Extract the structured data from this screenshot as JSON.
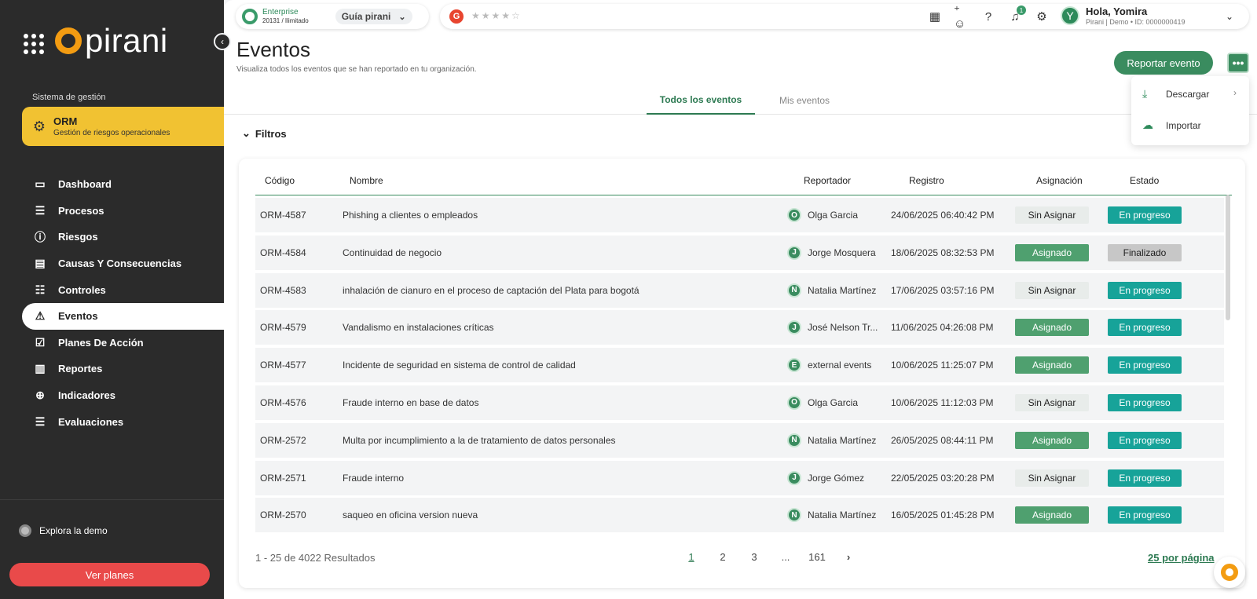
{
  "brand": {
    "name": "pirani",
    "accent": "#f39c12",
    "green": "#3a8c5f"
  },
  "sidebar": {
    "section_label": "Sistema de gestión",
    "module": {
      "title": "ORM",
      "subtitle": "Gestión de riesgos operacionales"
    },
    "items": [
      {
        "label": "Dashboard",
        "icon": "monitor-icon",
        "glyph": "▭"
      },
      {
        "label": "Procesos",
        "icon": "list-icon",
        "glyph": "☰"
      },
      {
        "label": "Riesgos",
        "icon": "alert-circle-icon",
        "glyph": "ⓘ"
      },
      {
        "label": "Causas Y Consecuencias",
        "icon": "layout-icon",
        "glyph": "▤"
      },
      {
        "label": "Controles",
        "icon": "sliders-icon",
        "glyph": "☷"
      },
      {
        "label": "Eventos",
        "icon": "warning-triangle-icon",
        "glyph": "⚠"
      },
      {
        "label": "Planes De Acción",
        "icon": "checkbox-icon",
        "glyph": "☑"
      },
      {
        "label": "Reportes",
        "icon": "bar-chart-icon",
        "glyph": "▥"
      },
      {
        "label": "Indicadores",
        "icon": "target-icon",
        "glyph": "⊕"
      },
      {
        "label": "Evaluaciones",
        "icon": "checklist-icon",
        "glyph": "☰"
      }
    ],
    "active_index": 5,
    "demo_label": "Explora la demo",
    "plans_button": "Ver planes"
  },
  "topbar": {
    "plan_title": "Enterprise",
    "plan_sub": "20131 / Ilimitado",
    "guide_label": "Guía pirani",
    "g2_label": "G",
    "stars": "★★★★☆",
    "notifications_count": "1",
    "avatar_initial": "Y",
    "user_name": "Hola, Yomira",
    "user_sub": "Pirani | Demo • ID: 0000000419"
  },
  "header": {
    "title": "Eventos",
    "subtitle": "Visualiza todos los eventos que se han reportado en tu organización.",
    "report_button": "Reportar evento",
    "more_label": "•••"
  },
  "tabs": [
    {
      "label": "Todos los eventos"
    },
    {
      "label": "Mis eventos"
    }
  ],
  "filters_label": "Filtros",
  "dropdown": {
    "items": [
      {
        "label": "Descargar"
      },
      {
        "label": "Importar"
      }
    ]
  },
  "table": {
    "columns": [
      "Código",
      "Nombre",
      "Reportador",
      "Registro",
      "Asignación",
      "Estado"
    ],
    "rows": [
      {
        "code": "ORM-4587",
        "name": "Phishing a clientes o empleados",
        "initial": "O",
        "reporter": "Olga Garcia",
        "date": "24/06/2025 06:40:42 PM",
        "assignment": "Sin Asignar",
        "assignment_kind": "unassigned",
        "status": "En progreso",
        "status_kind": "progress"
      },
      {
        "code": "ORM-4584",
        "name": "Continuidad de negocio",
        "initial": "J",
        "reporter": "Jorge Mosquera",
        "date": "18/06/2025 08:32:53 PM",
        "assignment": "Asignado",
        "assignment_kind": "assigned",
        "status": "Finalizado",
        "status_kind": "done"
      },
      {
        "code": "ORM-4583",
        "name": "inhalación de cianuro en el proceso de captación del Plata para bogotá",
        "initial": "N",
        "reporter": "Natalia Martínez",
        "date": "17/06/2025 03:57:16 PM",
        "assignment": "Sin Asignar",
        "assignment_kind": "unassigned",
        "status": "En progreso",
        "status_kind": "progress"
      },
      {
        "code": "ORM-4579",
        "name": "Vandalismo en instalaciones críticas",
        "initial": "J",
        "reporter": "José Nelson Tr...",
        "date": "11/06/2025 04:26:08 PM",
        "assignment": "Asignado",
        "assignment_kind": "assigned",
        "status": "En progreso",
        "status_kind": "progress"
      },
      {
        "code": "ORM-4577",
        "name": "Incidente de seguridad en sistema de control de calidad",
        "initial": "E",
        "reporter": "external events",
        "date": "10/06/2025 11:25:07 PM",
        "assignment": "Asignado",
        "assignment_kind": "assigned",
        "status": "En progreso",
        "status_kind": "progress"
      },
      {
        "code": "ORM-4576",
        "name": "Fraude interno en base de datos",
        "initial": "O",
        "reporter": "Olga Garcia",
        "date": "10/06/2025 11:12:03 PM",
        "assignment": "Sin Asignar",
        "assignment_kind": "unassigned",
        "status": "En progreso",
        "status_kind": "progress"
      },
      {
        "code": "ORM-2572",
        "name": "Multa por incumplimiento a la de tratamiento de datos personales",
        "initial": "N",
        "reporter": "Natalia Martínez",
        "date": "26/05/2025 08:44:11 PM",
        "assignment": "Asignado",
        "assignment_kind": "assigned",
        "status": "En progreso",
        "status_kind": "progress"
      },
      {
        "code": "ORM-2571",
        "name": "Fraude interno",
        "initial": "J",
        "reporter": "Jorge Gómez",
        "date": "22/05/2025 03:20:28 PM",
        "assignment": "Sin Asignar",
        "assignment_kind": "unassigned",
        "status": "En progreso",
        "status_kind": "progress"
      },
      {
        "code": "ORM-2570",
        "name": "saqueo en oficina version nueva",
        "initial": "N",
        "reporter": "Natalia Martínez",
        "date": "16/05/2025 01:45:28 PM",
        "assignment": "Asignado",
        "assignment_kind": "assigned",
        "status": "En progreso",
        "status_kind": "progress"
      }
    ]
  },
  "footer": {
    "results": "1 - 25 de 4022 Resultados",
    "pages": [
      "1",
      "2",
      "3",
      "...",
      "161"
    ],
    "current_page": "1",
    "next_label": "›",
    "per_page": "25 por página"
  }
}
